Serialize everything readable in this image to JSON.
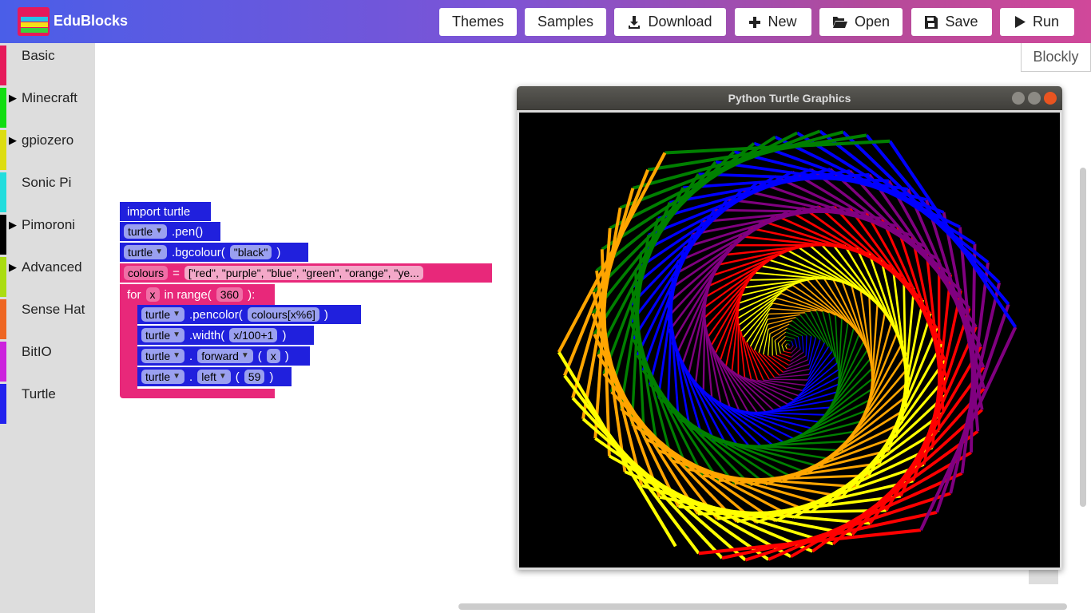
{
  "app": {
    "title": "EduBlocks",
    "logo_colors": [
      "#e6195a",
      "#27c2e8",
      "#f6e018",
      "#3bd23b"
    ]
  },
  "toolbar": {
    "themes_label": "Themes",
    "samples_label": "Samples",
    "download_label": "Download",
    "new_label": "New",
    "open_label": "Open",
    "save_label": "Save",
    "run_label": "Run"
  },
  "sidebar": {
    "categories": [
      {
        "label": "Basic",
        "color": "#e6195a",
        "expandable": false
      },
      {
        "label": "Minecraft",
        "color": "#11dd11",
        "expandable": true
      },
      {
        "label": "gpiozero",
        "color": "#dddd11",
        "expandable": true
      },
      {
        "label": "Sonic Pi",
        "color": "#22dddd",
        "expandable": false
      },
      {
        "label": "Pimoroni",
        "color": "#000000",
        "expandable": true
      },
      {
        "label": "Advanced",
        "color": "#aadd11",
        "expandable": true
      },
      {
        "label": "Sense Hat",
        "color": "#ee6622",
        "expandable": false
      },
      {
        "label": "BitIO",
        "color": "#cc22dd",
        "expandable": false
      },
      {
        "label": "Turtle",
        "color": "#2222ee",
        "expandable": false
      }
    ]
  },
  "workspace": {
    "mode_tab": "Blockly",
    "blocks": {
      "import": "import turtle",
      "turtle_var": "turtle",
      "pen": ".pen()",
      "bgcolour": ".bgcolour(",
      "bg_value": "\"black\"",
      "close_paren": ")",
      "colours_var": "colours",
      "equals": "=",
      "colours_value": "[\"red\", \"purple\", \"blue\", \"green\", \"orange\", \"ye...",
      "for_kw": "for",
      "loop_var": "x",
      "in_range": "in range(",
      "range_value": "360",
      "range_close": "):",
      "pencolor": ".pencolor(",
      "pencolor_value": "colours[x%6]",
      "width": ".width(",
      "width_value": "x/100+1",
      "dot": ".",
      "forward": "forward",
      "open_paren": "(",
      "forward_value": "x",
      "left": "left",
      "left_value": "59"
    }
  },
  "turtle_window": {
    "title": "Python Turtle Graphics",
    "background": "#000000",
    "spiral_colours": [
      "red",
      "purple",
      "blue",
      "green",
      "orange",
      "yellow"
    ],
    "iterations": 360,
    "turn_angle": 59
  }
}
